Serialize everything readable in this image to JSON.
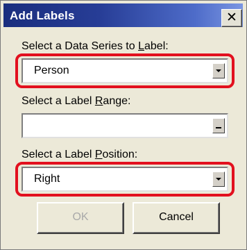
{
  "dialog": {
    "title": "Add Labels",
    "close_symbol": "✕"
  },
  "series": {
    "label_pre": "Select a Data Series to ",
    "label_key": "L",
    "label_post": "abel:",
    "value": "Person",
    "highlighted": true
  },
  "range": {
    "label_pre": "Select a Label ",
    "label_key": "R",
    "label_post": "ange:",
    "value": ""
  },
  "position": {
    "label_pre": "Select a Label ",
    "label_key": "P",
    "label_post": "osition:",
    "value": "Right",
    "highlighted": true
  },
  "buttons": {
    "ok_label": "OK",
    "ok_enabled": false,
    "cancel_label": "Cancel"
  },
  "colors": {
    "highlight": "#e2101e",
    "titlebar": "#1a2e7e",
    "dialog_bg": "#ece9d8"
  },
  "icons": {
    "close": "close-icon",
    "dropdown": "chevron-down-icon",
    "range_picker": "range-select-icon"
  }
}
